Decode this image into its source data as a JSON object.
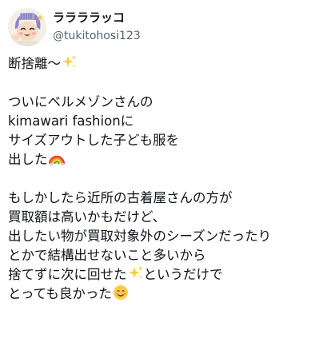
{
  "user": {
    "display_name": "ララララッコ",
    "handle": "@tukitohosi123",
    "avatar_icon": "anime-character-avatar-icon"
  },
  "tweet": {
    "lines": [
      "断捨離～",
      "",
      "ついにベルメゾンさんの",
      "kimawari fashionに",
      "サイズアウトした子ども服を",
      "出した",
      "",
      "もしかしたら近所の古着屋さんの方が",
      "買取額は高いかもだけど、",
      "出したい物が買取対象外のシーズンだったり",
      "とかで結構出せないこと多いから",
      "捨てずに次に回せた",
      "というだけで",
      "とっても良かった"
    ],
    "emojis": {
      "sparkles": "sparkles-emoji",
      "rainbow": "rainbow-emoji",
      "smile": "smiling-face-emoji"
    }
  }
}
